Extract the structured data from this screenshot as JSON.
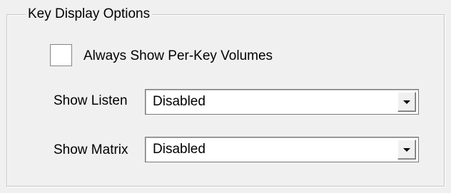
{
  "group": {
    "title": "Key Display Options"
  },
  "always_show_volumes": {
    "label": "Always Show Per-Key Volumes",
    "checked": false
  },
  "show_listen": {
    "label": "Show Listen",
    "value": "Disabled",
    "button_icon": "chevron-down-icon"
  },
  "show_matrix": {
    "label": "Show Matrix",
    "value": "Disabled",
    "button_icon": "chevron-down-icon"
  }
}
